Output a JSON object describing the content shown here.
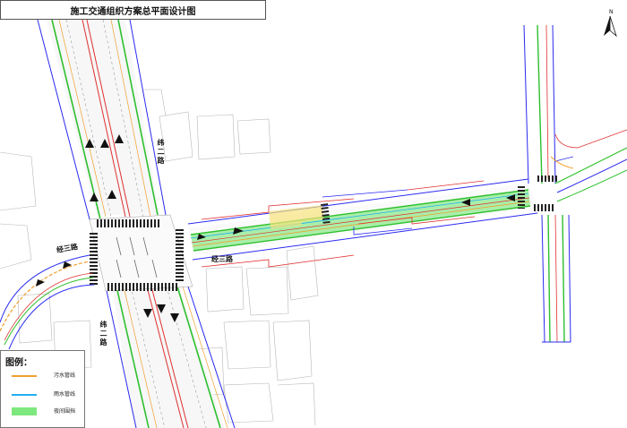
{
  "title": "施工交通组织方案总平面设计图",
  "roads": {
    "vertical_main": "纬二路",
    "vertical_main_lower": "纬二路",
    "horizontal_main": "经三路",
    "horizontal_main_left": "经三路"
  },
  "legend": {
    "title": "图例：",
    "items": [
      {
        "label": "污水管线",
        "color": "#f0a030",
        "kind": "line"
      },
      {
        "label": "雨水管线",
        "color": "#20b0f0",
        "kind": "line"
      },
      {
        "label": "夜间围挡",
        "color": "#7ee87e",
        "kind": "fill"
      }
    ]
  },
  "compass": {
    "label": "N",
    "icon": "north-arrow-icon"
  },
  "colors": {
    "road_edge": "#2a2af0",
    "green_lane": "#2ec02e",
    "red_line": "#e03030",
    "orange_line": "#f0a030",
    "cyan_line": "#20b0f0",
    "fence_fill": "#7ee87e",
    "gray": "#9a9a9a"
  }
}
